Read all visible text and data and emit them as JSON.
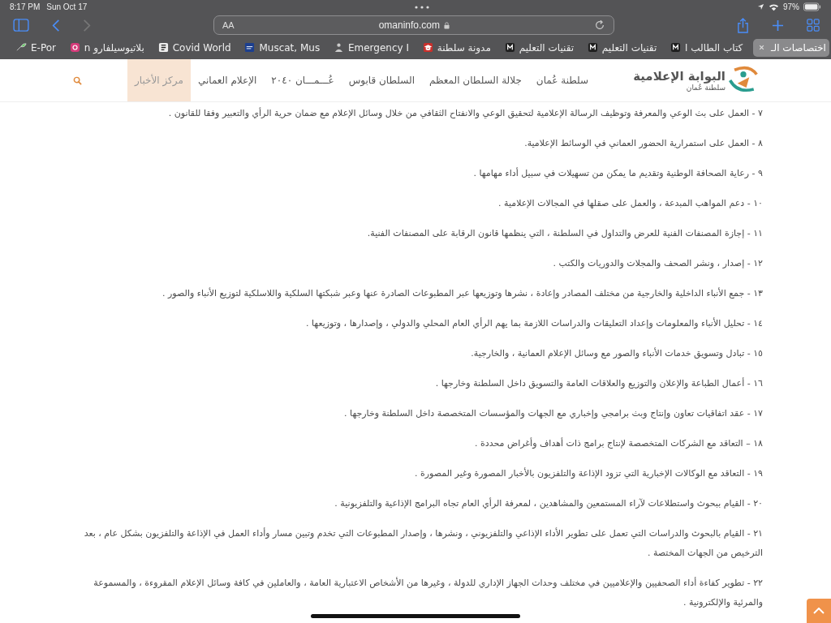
{
  "status_bar": {
    "time": "8:17 PM",
    "date": "Sun Oct 17",
    "battery": "97%"
  },
  "browser": {
    "text_size_button": "AA",
    "url": "omaninfo.com"
  },
  "bookmarks": [
    {
      "label": "اختصاصات الـ",
      "kind": "close",
      "selected": true
    },
    {
      "label": "كتاب الطالب ا",
      "kind": "m",
      "selected": false
    },
    {
      "label": "تقنيات التعليم",
      "kind": "m",
      "selected": false
    },
    {
      "label": "تقنيات التعليم",
      "kind": "m",
      "selected": false
    },
    {
      "label": "مدونة سلطنة",
      "kind": "cap",
      "selected": false
    },
    {
      "label": "Emergency I",
      "kind": "person",
      "selected": false
    },
    {
      "label": "Muscat, Mus",
      "kind": "news",
      "selected": false
    },
    {
      "label": "Covid World",
      "kind": "paper",
      "selected": false
    },
    {
      "label": "بلاتيوسيلفارو n",
      "kind": "camera",
      "selected": false
    },
    {
      "label": "E-Por",
      "kind": "leaf",
      "selected": false
    }
  ],
  "site": {
    "logo_title": "البوابة الإعلامية",
    "logo_subtitle": "سلطنة عُمان",
    "nav": [
      {
        "label": "سلطنة عُمان",
        "selected": false
      },
      {
        "label": "جلالة السلطان المعظم",
        "selected": false
      },
      {
        "label": "السلطان قابوس",
        "selected": false
      },
      {
        "label": "عُـــمـــان ٢٠٤٠",
        "selected": false
      },
      {
        "label": "الإعلام العماني",
        "selected": false
      },
      {
        "label": "مركز الأخبار",
        "selected": true
      }
    ]
  },
  "items": [
    "٧ - العمل على بث الوعي والمعرفة وتوظيف الرسالة الإعلامية لتحقيق الوعي والانفتاح الثقافي من خلال وسائل الإعلام مع ضمان حرية الرأي والتعبير وفقا للقانون .",
    "٨ - العمل على استمرارية الحضور العماني في الوسائط الإعلامية.",
    "٩ - رعاية الصحافة الوطنية وتقديم ما يمكن من تسهيلات في سبيل أداء مهامها .",
    "١٠ - دعم المواهب المبدعة ، والعمل على صقلها في المجالات الإعلامية .",
    "١١ - إجازة المصنفات الفنية للعرض والتداول في السلطنة ، التي ينظمها قانون الرقابة على المصنفات الفنية.",
    "١٢ - إصدار ، ونشر الصحف والمجلات والدوريات والكتب .",
    "١٣ - جمع الأنباء الداخلية والخارجية من مختلف المصادر وإعادة ، نشرها وتوزيعها عبر المطبوعات الصادرة عنها وعبر شبكتها السلكية واللاسلكية لتوزيع الأنباء والصور .",
    "١٤ - تحليل الأنباء والمعلومات وإعداد التعليقات والدراسات اللازمة بما يهم الرأي العام المحلي والدولي ، وإصدارها ، وتوزيعها .",
    "١٥ - تبادل وتسويق خدمات الأنباء والصور مع وسائل الإعلام العمانية ، والخارجية.",
    "١٦ - أعمال الطباعة والإعلان والتوزيع والعلاقات العامة والتسويق داخل السلطنة وخارجها .",
    "١٧ - عقد اتفاقيات تعاون وإنتاج وبث برامجي وإخباري مع الجهات والمؤسسات المتخصصة داخل السلطنة وخارجها .",
    "١٨ – التعاقد مع الشركات المتخصصة لإنتاج برامج ذات أهداف وأغراض محددة .",
    "١٩ - التعاقد مع الوكالات الإخبارية التي تزود الإذاعة والتلفزيون بالأخبار المصورة وغير المصورة .",
    "٢٠ - القيام ببحوث واستطلاعات لآراء المستمعين والمشاهدين ، لمعرفة الرأي العام تجاه البرامج الإذاعية والتلفزيونية .",
    "٢١ - القيام بالبحوث والدراسات التي تعمل على تطوير الأداء الإذاعي والتلفزيوني ، ونشرها ، وإصدار المطبوعات التي تخدم وتبين مسار وأداء العمل في الإذاعة والتلفزيون بشكل عام ، بعد الترخيص من الجهات المختصة .",
    "٢٢ - تطوير كفاءة أداء الصحفيين والإعلاميين في مختلف وحدات الجهاز الإداري للدولة ، وغيرها من الأشخاص الاعتبارية العامة ، والعاملين في كافة وسائل الإعلام المقروءة ، والمسموعة والمرئية والإلكترونية ."
  ]
}
